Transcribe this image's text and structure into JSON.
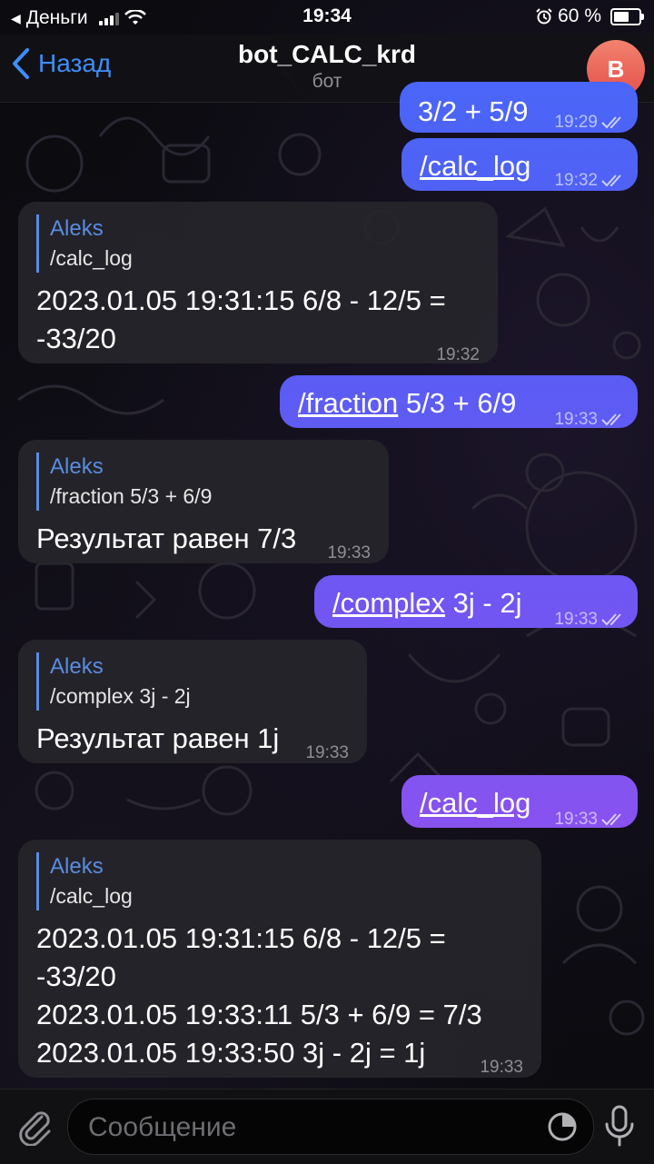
{
  "status_bar": {
    "back_app": "Деньги",
    "time": "19:34",
    "battery": "60 %",
    "battery_level": 0.6
  },
  "header": {
    "back_label": "Назад",
    "title": "bot_CALC_krd",
    "subtitle": "бот",
    "avatar_letter": "B"
  },
  "messages": [
    {
      "dir": "out",
      "text": "3/2 + 5/9",
      "time": "19:29"
    },
    {
      "dir": "out",
      "cmd": "/calc_log",
      "text": "",
      "time": "19:32"
    },
    {
      "dir": "in",
      "quote_name": "Aleks",
      "quote_text": "/calc_log",
      "lines": [
        "2023.01.05 19:31:15   6/8 - 12/5 =",
        "-33/20"
      ],
      "time": "19:32"
    },
    {
      "dir": "out",
      "cmd": "/fraction",
      "text": " 5/3 + 6/9",
      "time": "19:33"
    },
    {
      "dir": "in",
      "quote_name": "Aleks",
      "quote_text": "/fraction 5/3 + 6/9",
      "lines": [
        "Результат равен 7/3"
      ],
      "time": "19:33"
    },
    {
      "dir": "out",
      "cmd": "/complex",
      "text": " 3j - 2j",
      "time": "19:33"
    },
    {
      "dir": "in",
      "quote_name": "Aleks",
      "quote_text": "/complex 3j - 2j",
      "lines": [
        "Результат равен 1j"
      ],
      "time": "19:33"
    },
    {
      "dir": "out",
      "cmd": "/calc_log",
      "text": "",
      "time": "19:33"
    },
    {
      "dir": "in",
      "quote_name": "Aleks",
      "quote_text": "/calc_log",
      "lines": [
        "2023.01.05 19:31:15   6/8 - 12/5 =",
        "-33/20",
        "2023.01.05 19:33:11   5/3 + 6/9 = 7/3",
        "2023.01.05 19:33:50   3j - 2j = 1j"
      ],
      "time": "19:33"
    }
  ],
  "input": {
    "placeholder": "Сообщение"
  },
  "colors": {
    "accent": "#3e8ef7",
    "outgoing_top": "#4a6cf7",
    "outgoing_bottom": "#8a52f0",
    "incoming": "#26252b",
    "quote": "#5a8ce0"
  }
}
